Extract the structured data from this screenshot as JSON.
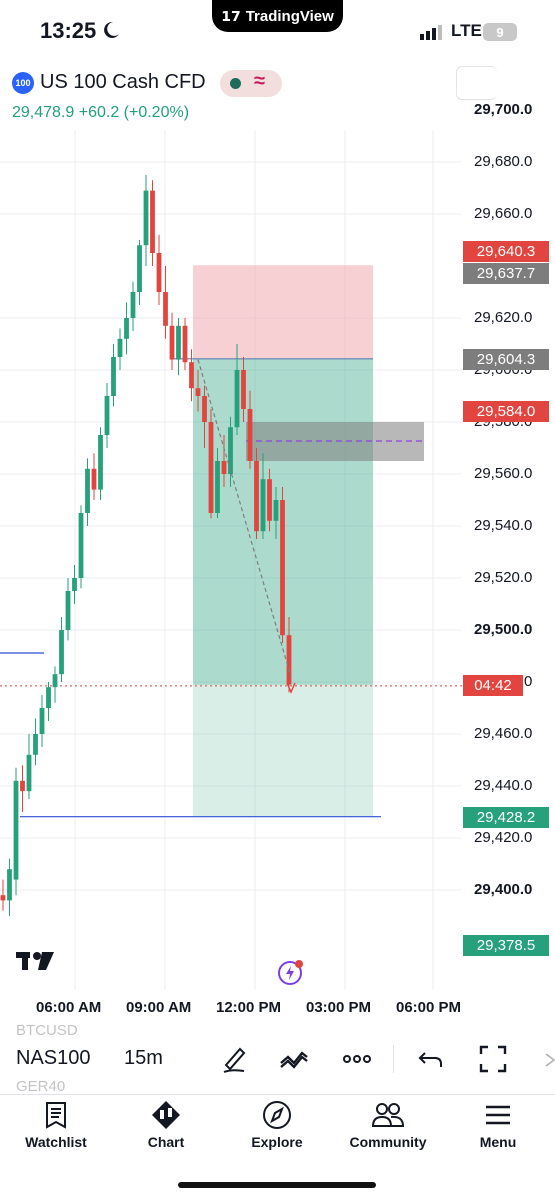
{
  "status_bar": {
    "time": "13:25",
    "network": "LTE",
    "battery": "9"
  },
  "top_pill": {
    "brand": "TradingView"
  },
  "symbol_header": {
    "badge": "100",
    "title": "US 100 Cash CFD",
    "price_line": "29,478.9  +60.2 (+0.20%)"
  },
  "price_axis": {
    "labels": [
      "29,700.0",
      "29,680.0",
      "29,660.0",
      "29,620.0",
      "29,600.0",
      "29,580.0",
      "29,560.0",
      "29,540.0",
      "29,520.0",
      "29,500.0",
      "29,480.0",
      "29,460.0",
      "29,440.0",
      "29,420.0",
      "29,400.0"
    ],
    "tags": {
      "sl": "29,640.3",
      "high_ref": "29,637.7",
      "entry": "29,604.3",
      "alert": "29,584.0",
      "countdown": "04:42",
      "target": "29,428.2",
      "low_ref": "29,378.5"
    }
  },
  "time_axis": {
    "labels": [
      "06:00 AM",
      "09:00 AM",
      "12:00 PM",
      "03:00 PM",
      "06:00 PM"
    ]
  },
  "chart_data": {
    "type": "candlestick",
    "interval": "15m",
    "ylim": [
      29370,
      29710
    ],
    "current_price": 29478.9,
    "candles": [
      {
        "o": 29398,
        "h": 29404,
        "l": 29392,
        "c": 29396
      },
      {
        "o": 29396,
        "h": 29412,
        "l": 29390,
        "c": 29408
      },
      {
        "o": 29404,
        "h": 29447,
        "l": 29398,
        "c": 29442
      },
      {
        "o": 29442,
        "h": 29448,
        "l": 29430,
        "c": 29438
      },
      {
        "o": 29438,
        "h": 29460,
        "l": 29435,
        "c": 29452
      },
      {
        "o": 29452,
        "h": 29466,
        "l": 29448,
        "c": 29460
      },
      {
        "o": 29460,
        "h": 29475,
        "l": 29455,
        "c": 29470
      },
      {
        "o": 29470,
        "h": 29480,
        "l": 29465,
        "c": 29478
      },
      {
        "o": 29478,
        "h": 29486,
        "l": 29472,
        "c": 29483
      },
      {
        "o": 29483,
        "h": 29505,
        "l": 29480,
        "c": 29500
      },
      {
        "o": 29500,
        "h": 29520,
        "l": 29496,
        "c": 29515
      },
      {
        "o": 29515,
        "h": 29525,
        "l": 29510,
        "c": 29520
      },
      {
        "o": 29520,
        "h": 29548,
        "l": 29516,
        "c": 29545
      },
      {
        "o": 29545,
        "h": 29566,
        "l": 29540,
        "c": 29562
      },
      {
        "o": 29562,
        "h": 29568,
        "l": 29550,
        "c": 29554
      },
      {
        "o": 29554,
        "h": 29578,
        "l": 29550,
        "c": 29575
      },
      {
        "o": 29575,
        "h": 29595,
        "l": 29570,
        "c": 29590
      },
      {
        "o": 29590,
        "h": 29610,
        "l": 29586,
        "c": 29605
      },
      {
        "o": 29605,
        "h": 29616,
        "l": 29600,
        "c": 29612
      },
      {
        "o": 29612,
        "h": 29626,
        "l": 29606,
        "c": 29620
      },
      {
        "o": 29620,
        "h": 29634,
        "l": 29615,
        "c": 29630
      },
      {
        "o": 29630,
        "h": 29650,
        "l": 29625,
        "c": 29648
      },
      {
        "o": 29648,
        "h": 29675,
        "l": 29640,
        "c": 29669
      },
      {
        "o": 29669,
        "h": 29673,
        "l": 29640,
        "c": 29645
      },
      {
        "o": 29645,
        "h": 29652,
        "l": 29625,
        "c": 29630
      },
      {
        "o": 29630,
        "h": 29640,
        "l": 29612,
        "c": 29617
      },
      {
        "o": 29617,
        "h": 29622,
        "l": 29600,
        "c": 29604
      },
      {
        "o": 29604,
        "h": 29620,
        "l": 29598,
        "c": 29617
      },
      {
        "o": 29617,
        "h": 29620,
        "l": 29600,
        "c": 29603
      },
      {
        "o": 29603,
        "h": 29608,
        "l": 29588,
        "c": 29593
      },
      {
        "o": 29593,
        "h": 29600,
        "l": 29584,
        "c": 29590
      },
      {
        "o": 29590,
        "h": 29594,
        "l": 29570,
        "c": 29580
      },
      {
        "o": 29580,
        "h": 29585,
        "l": 29543,
        "c": 29545
      },
      {
        "o": 29545,
        "h": 29570,
        "l": 29543,
        "c": 29565
      },
      {
        "o": 29565,
        "h": 29575,
        "l": 29555,
        "c": 29560
      },
      {
        "o": 29560,
        "h": 29582,
        "l": 29555,
        "c": 29578
      },
      {
        "o": 29578,
        "h": 29610,
        "l": 29575,
        "c": 29600
      },
      {
        "o": 29600,
        "h": 29605,
        "l": 29580,
        "c": 29585
      },
      {
        "o": 29585,
        "h": 29592,
        "l": 29562,
        "c": 29565
      },
      {
        "o": 29565,
        "h": 29570,
        "l": 29535,
        "c": 29538
      },
      {
        "o": 29538,
        "h": 29568,
        "l": 29535,
        "c": 29558
      },
      {
        "o": 29558,
        "h": 29562,
        "l": 29538,
        "c": 29542
      },
      {
        "o": 29542,
        "h": 29555,
        "l": 29535,
        "c": 29550
      },
      {
        "o": 29550,
        "h": 29555,
        "l": 29495,
        "c": 29498
      },
      {
        "o": 29498,
        "h": 29505,
        "l": 29476,
        "c": 29479
      }
    ],
    "position": {
      "type": "short",
      "entry": 29604.3,
      "stop": 29640.3,
      "target": 29428.2
    },
    "levels": [
      29584.0,
      29637.7,
      29378.5
    ]
  },
  "toolbar": {
    "symbol": "NAS100",
    "interval": "15m",
    "recent_above": "BTCUSD",
    "recent_below": "GER40"
  },
  "nav": {
    "items": [
      {
        "label": "Watchlist",
        "icon": "watchlist-icon"
      },
      {
        "label": "Chart",
        "icon": "chart-icon"
      },
      {
        "label": "Explore",
        "icon": "compass-icon"
      },
      {
        "label": "Community",
        "icon": "community-icon"
      },
      {
        "label": "Menu",
        "icon": "menu-icon"
      }
    ]
  },
  "colors": {
    "up": "#26a17b",
    "down": "#e2453f",
    "tp_zone": "#26a17b",
    "sl_zone": "#f0a1a8",
    "tag_red": "#e2453f",
    "tag_gray": "#7d7d7d",
    "tag_green": "#26a17b"
  }
}
